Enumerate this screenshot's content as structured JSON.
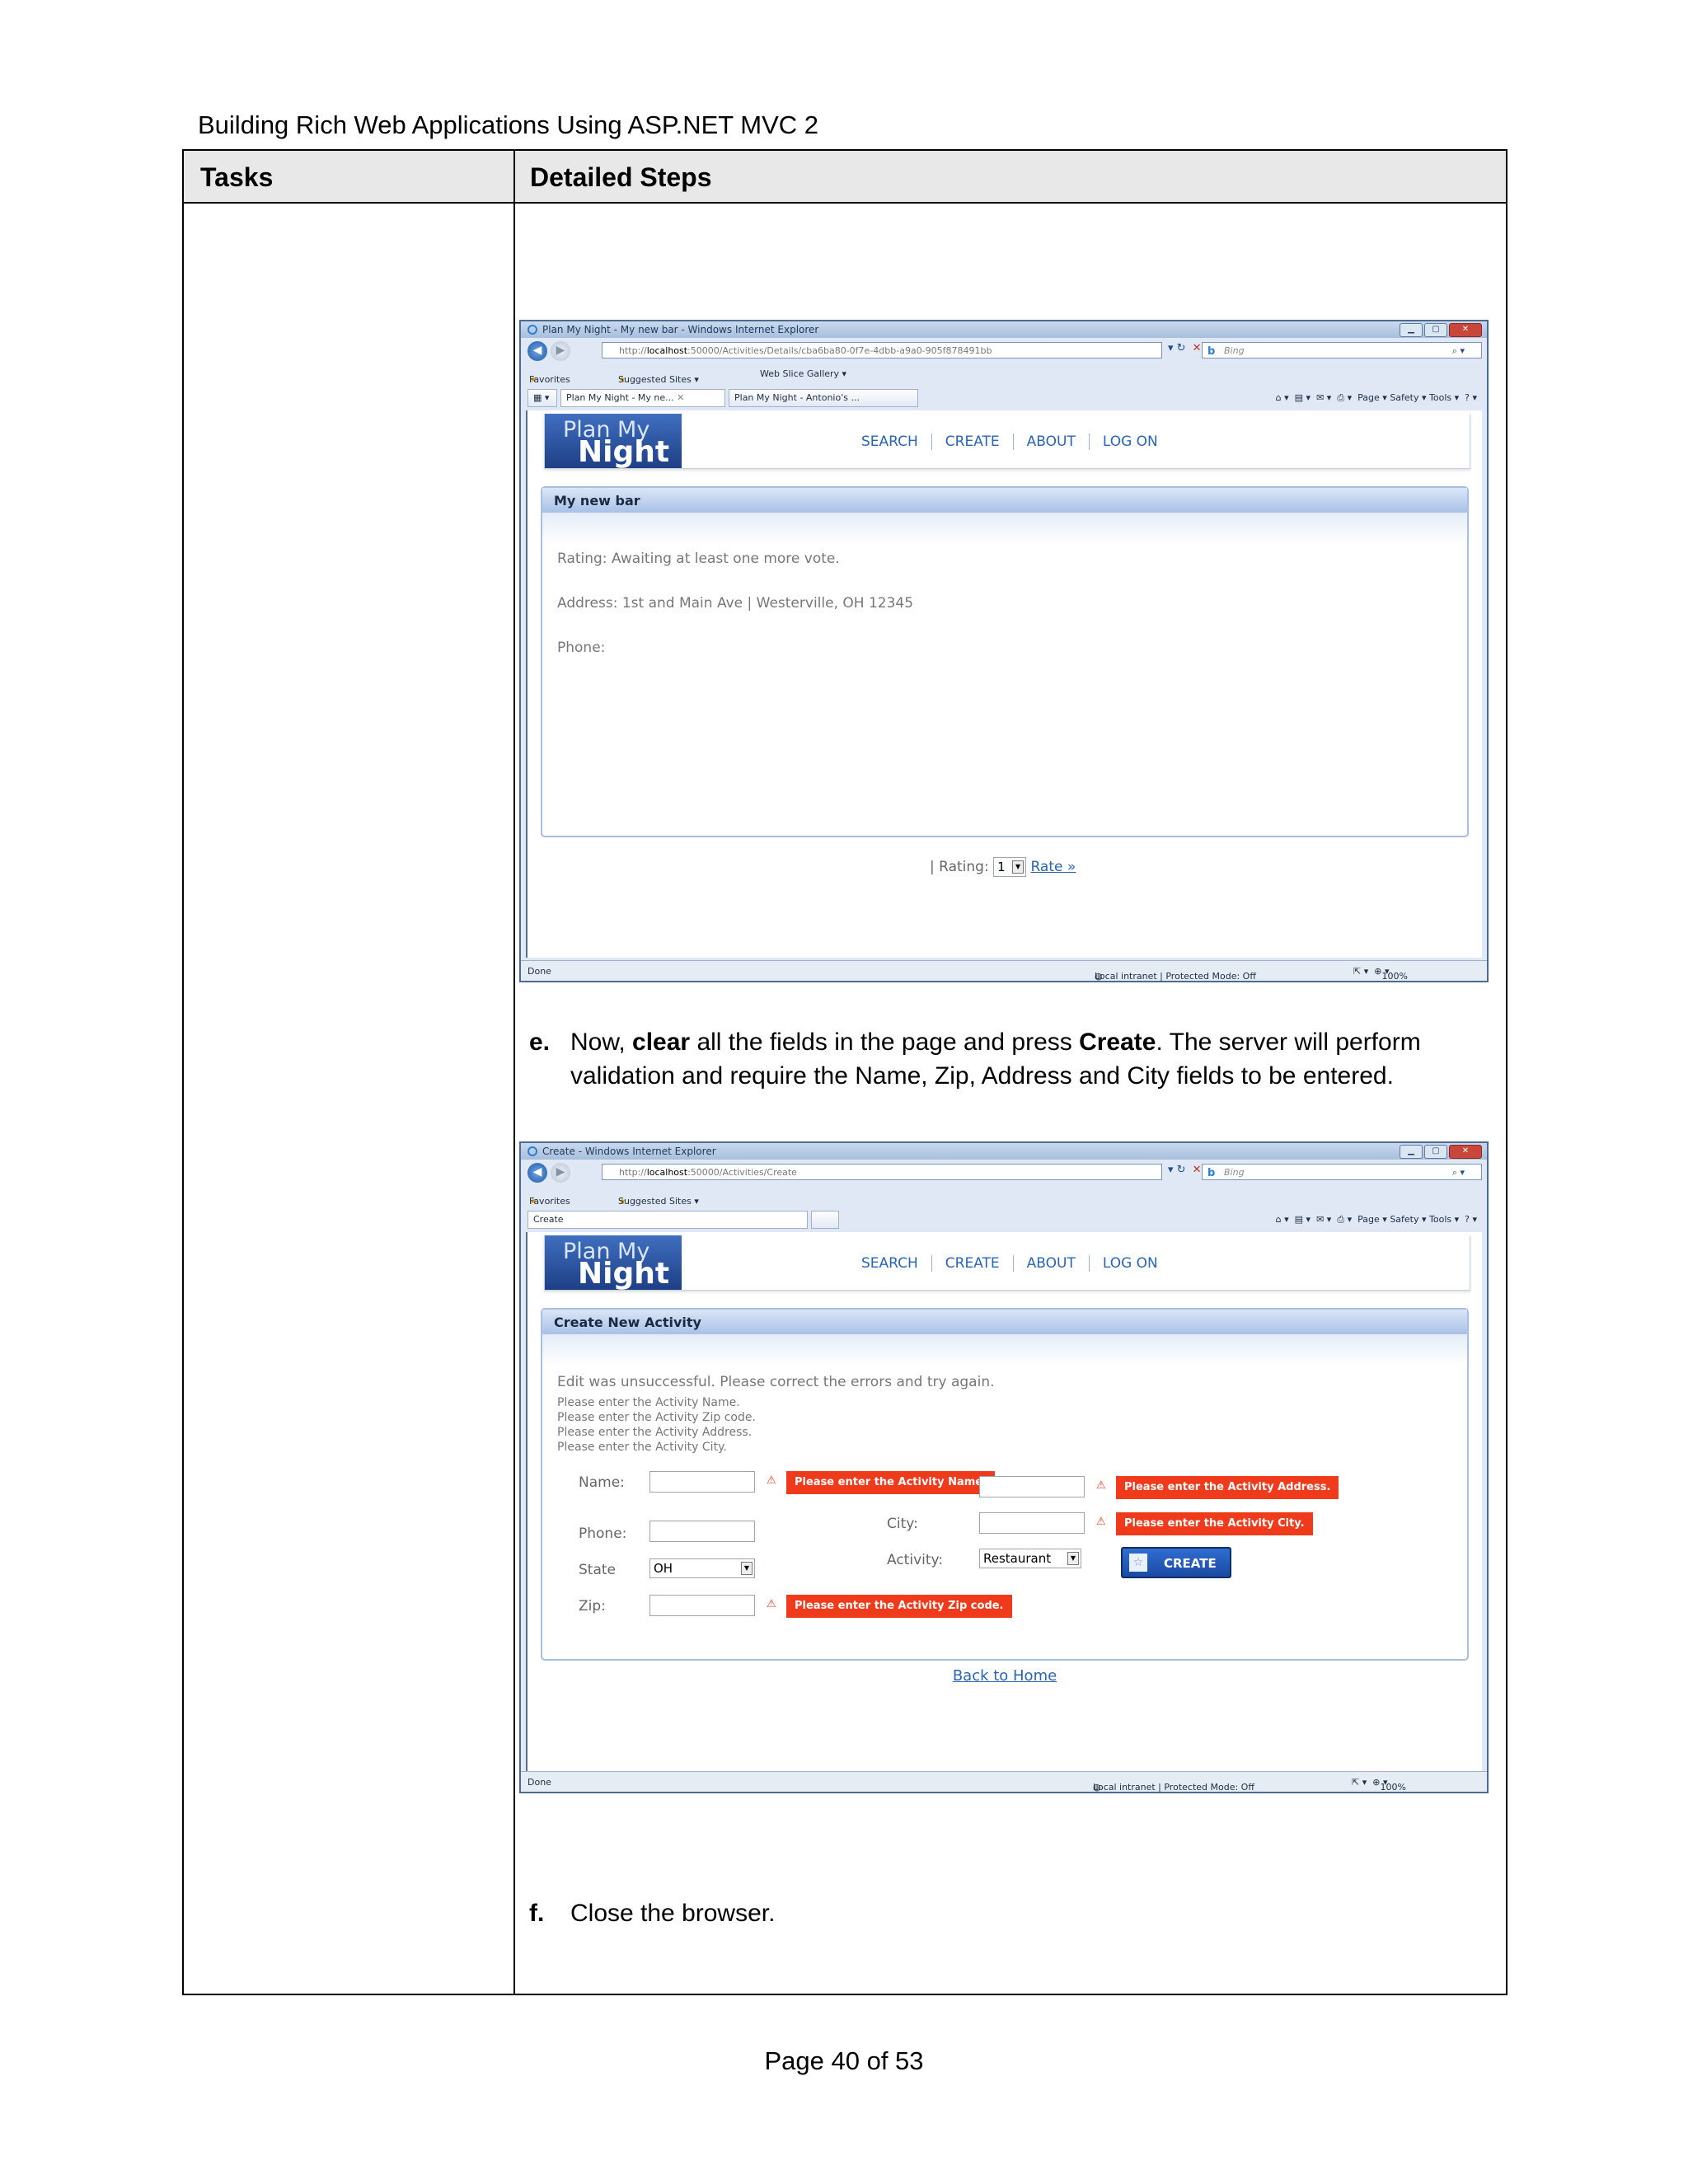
{
  "document": {
    "title": "Building Rich Web Applications Using ASP.NET MVC 2",
    "columns": {
      "tasks": "Tasks",
      "steps": "Detailed Steps"
    },
    "step_e": {
      "index": "e.",
      "pre": "Now, ",
      "bold1": "clear",
      "mid": " all the fields in the page and press ",
      "bold2": "Create",
      "post": ". The server will perform validation and require the Name, Zip, Address and City fields to be entered."
    },
    "step_f": {
      "index": "f.",
      "text": "Close the browser."
    },
    "footer": "Page 40 of 53"
  },
  "browser1": {
    "window_title": "Plan My Night - My new bar - Windows Internet Explorer",
    "url_prefix": "http://",
    "url_host": "localhost",
    "url_rest": ":50000/Activities/Details/cba6ba80-0f7e-4dbb-a9a0-905f878491bb",
    "search_placeholder": "Bing",
    "favorites": "Favorites",
    "suggested_sites": "Suggested Sites ▾",
    "web_slice": "Web Slice Gallery ▾",
    "tab1": "Plan My Night - My ne...",
    "tab2": "Plan My Night - Antonio's ...",
    "commands": "Page ▾   Safety ▾   Tools ▾",
    "status_done": "Done",
    "status_zone": "Local intranet | Protected Mode: Off",
    "zoom": "100%",
    "logo_line1": "Plan My",
    "logo_line2": "Night",
    "menu": [
      "SEARCH",
      "CREATE",
      "ABOUT",
      "LOG ON"
    ],
    "panel_title": "My new bar",
    "rating_text": "Rating: Awaiting at least one more vote.",
    "address_text": "Address: 1st and Main Ave | Westerville, OH 12345",
    "phone_text": "Phone:",
    "rating_label": "| Rating:",
    "rating_value": "1",
    "rate_link": "Rate »"
  },
  "browser2": {
    "window_title": "Create - Windows Internet Explorer",
    "url_prefix": "http://",
    "url_host": "localhost",
    "url_rest": ":50000/Activities/Create",
    "search_placeholder": "Bing",
    "favorites": "Favorites",
    "suggested_sites": "Suggested Sites ▾",
    "tab1": "Create",
    "commands": "Page ▾   Safety ▾   Tools ▾",
    "status_done": "Done",
    "status_zone": "Local intranet | Protected Mode: Off",
    "zoom": "100%",
    "logo_line1": "Plan My",
    "logo_line2": "Night",
    "menu": [
      "SEARCH",
      "CREATE",
      "ABOUT",
      "LOG ON"
    ],
    "panel_title": "Create New Activity",
    "summary": "Edit was unsuccessful. Please correct the errors and try again.",
    "errors": [
      "Please enter the Activity Name.",
      "Please enter the Activity Zip code.",
      "Please enter the Activity Address.",
      "Please enter the Activity City."
    ],
    "labels": {
      "name": "Name:",
      "phone": "Phone:",
      "state": "State",
      "zip": "Zip:",
      "city": "City:",
      "activity": "Activity:"
    },
    "state_value": "OH",
    "activity_value": "Restaurant",
    "msg_name": "Please enter the Activity Name.",
    "msg_address": "Please enter the Activity Address.",
    "msg_city": "Please enter the Activity City.",
    "msg_zip": "Please enter the Activity Zip code.",
    "create_button": "CREATE",
    "back_link": "Back to Home"
  },
  "colors": {
    "error_red": "#ef3b1c",
    "link_blue": "#2a64b6",
    "header_gray": "#e8e8e8"
  }
}
